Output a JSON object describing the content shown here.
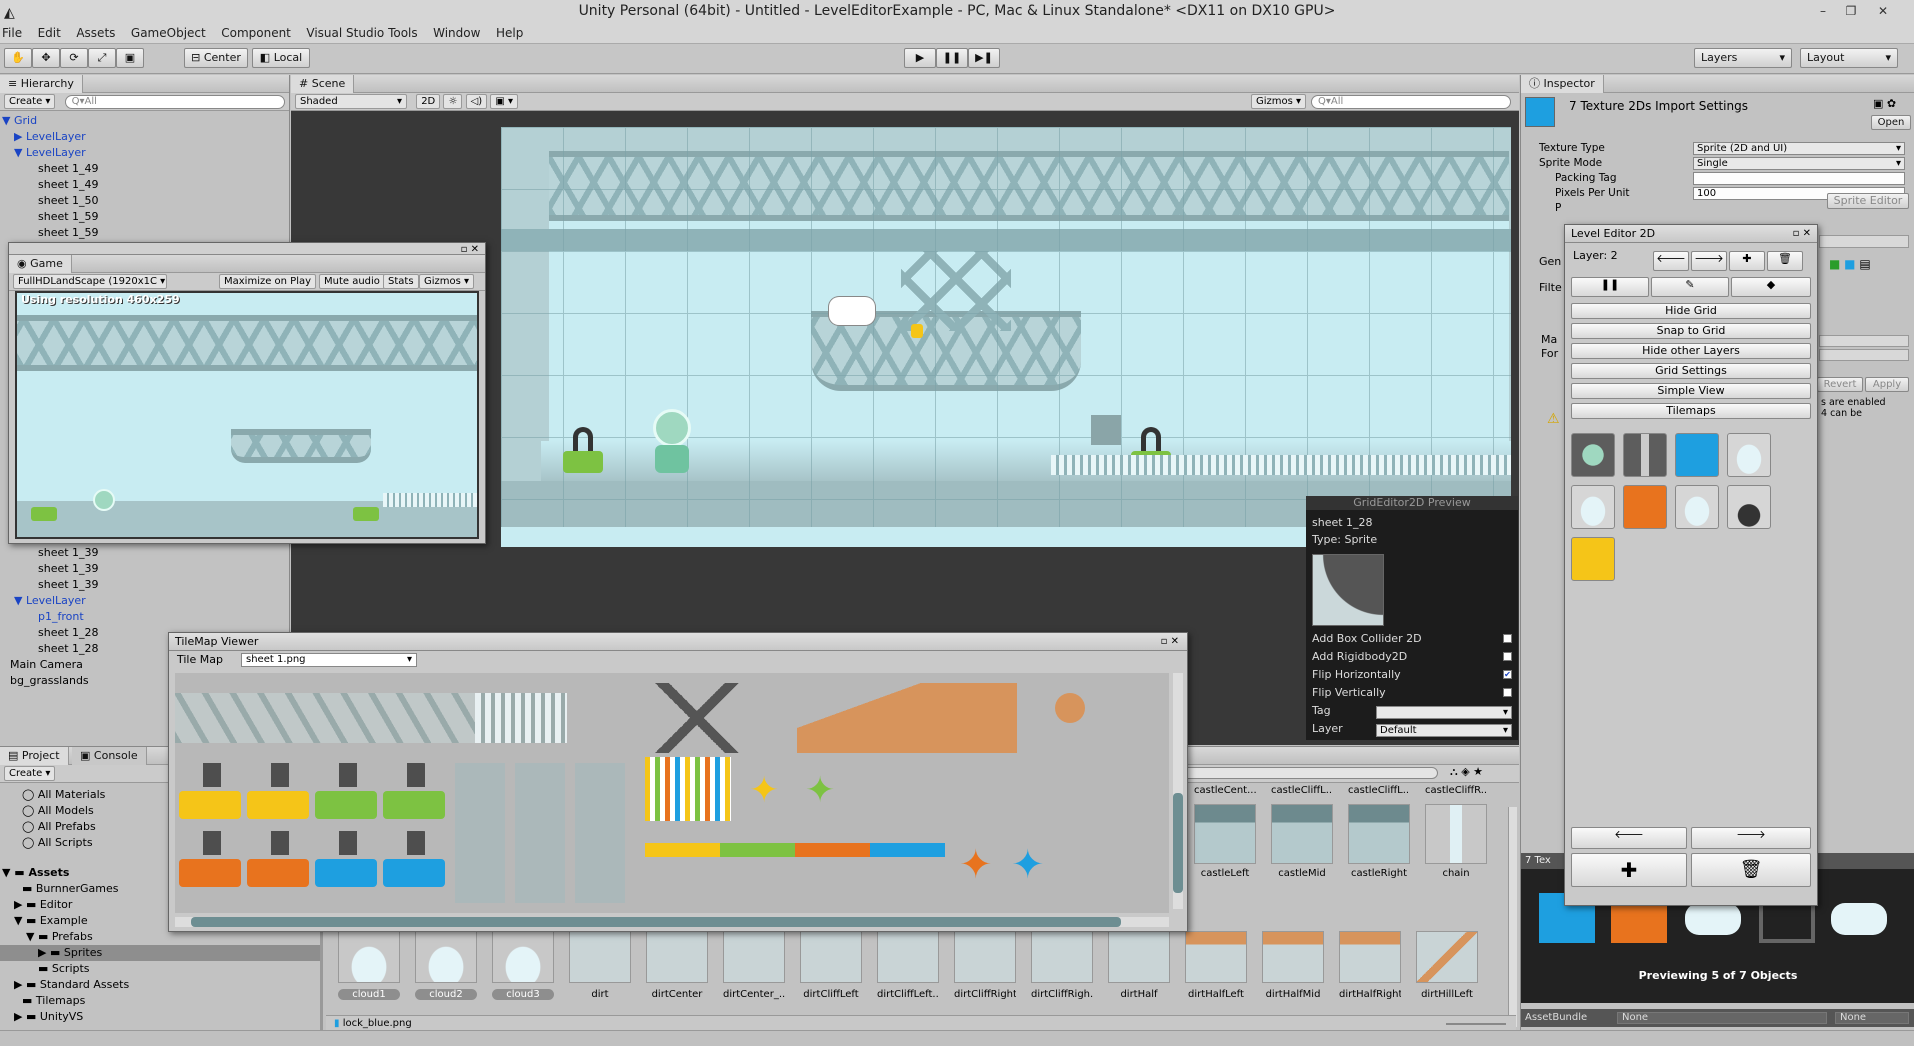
{
  "window": {
    "title": "Unity Personal (64bit) - Untitled - LevelEditorExample - PC, Mac & Linux Standalone* <DX11 on DX10 GPU>",
    "controls": [
      "–",
      "❐",
      "✕"
    ]
  },
  "menu": [
    "File",
    "Edit",
    "Assets",
    "GameObject",
    "Component",
    "Visual Studio Tools",
    "Window",
    "Help"
  ],
  "toolbar": {
    "pivot": "Center",
    "space": "Local",
    "layers": "Layers",
    "layout": "Layout"
  },
  "hierarchy": {
    "tab": "Hierarchy",
    "create": "Create",
    "search_placeholder": "Q▾All",
    "items_top": [
      "Grid",
      "LevelLayer",
      "LevelLayer",
      "sheet 1_49",
      "sheet 1_49",
      "sheet 1_50",
      "sheet 1_59",
      "sheet 1_59"
    ],
    "items_bottom": [
      "sheet 1_39",
      "sheet 1_39",
      "sheet 1_39",
      "LevelLayer",
      "p1_front",
      "sheet 1_28",
      "sheet 1_28",
      "Main Camera",
      "bg_grasslands"
    ]
  },
  "scene": {
    "tab": "Scene",
    "shading": "Shaded",
    "mode2d": "2D",
    "gizmos": "Gizmos",
    "search_placeholder": "Q▾All"
  },
  "game": {
    "tab": "Game",
    "resolution": "FullHDLandScape (1920x1C",
    "maximize": "Maximize on Play",
    "mute": "Mute audio",
    "stats": "Stats",
    "gizmos": "Gizmos",
    "overlay": "Using resolution 460x259"
  },
  "tilemap_viewer": {
    "title": "TileMap Viewer",
    "label": "Tile Map",
    "selected": "sheet 1.png"
  },
  "grid_preview": {
    "title": "GridEditor2D Preview",
    "name": "sheet 1_28",
    "type": "Type: Sprite",
    "options": [
      {
        "label": "Add Box Collider 2D",
        "checked": false
      },
      {
        "label": "Add Rigidbody2D",
        "checked": false
      },
      {
        "label": "Flip Horizontally",
        "checked": true
      },
      {
        "label": "Flip Vertically",
        "checked": false
      }
    ],
    "tag_label": "Tag",
    "tag_value": "",
    "layer_label": "Layer",
    "layer_value": "Default"
  },
  "project": {
    "tab": "Project",
    "console_tab": "Console",
    "create": "Create",
    "favorites": [
      "All Materials",
      "All Models",
      "All Prefabs",
      "All Scripts"
    ],
    "assets_root": "Assets",
    "tree": [
      "BurnnerGames",
      "Editor",
      "Example",
      "Prefabs",
      "Sprites",
      "Scripts",
      "Standard Assets",
      "Tilemaps",
      "UnityVS"
    ],
    "assets_row1_top": [
      "castleCent...",
      "castleCliffL...",
      "castleCliffL...",
      "castleCliffR..."
    ],
    "assets_row1_bottom": [
      "castleLeft",
      "castleMid",
      "castleRight",
      "chain"
    ],
    "assets_row2": [
      "cloud1",
      "cloud2",
      "cloud3",
      "dirt",
      "dirtCenter",
      "dirtCenter_...",
      "dirtCliffLeft",
      "dirtCliffLeft...",
      "dirtCliffRight",
      "dirtCliffRigh...",
      "dirtHalf",
      "dirtHalfLeft",
      "dirtHalfMid",
      "dirtHalfRight",
      "dirtHillLeft"
    ],
    "status_file": "lock_blue.png"
  },
  "inspector": {
    "tab": "Inspector",
    "header": "7 Texture 2Ds Import Settings",
    "open": "Open",
    "rows": [
      {
        "label": "Texture Type",
        "value": "Sprite (2D and UI)"
      },
      {
        "label": "Sprite Mode",
        "value": "Single"
      },
      {
        "label": "Packing Tag",
        "value": ""
      },
      {
        "label": "Pixels Per Unit",
        "value": "100"
      }
    ],
    "pivot_short": "P",
    "sprite_editor": "Sprite Editor",
    "gen_label": "Gen",
    "filter_label": "Filte",
    "max_label": "Ma",
    "format_label": "For",
    "revert": "Revert",
    "apply": "Apply",
    "warn_text_1": "s are enabled",
    "warn_text_2": "4 can be",
    "preview_tab": "7 Tex",
    "preview_caption": "Previewing 5 of 7 Objects",
    "assetbundle_label": "AssetBundle",
    "assetbundle_value": "None",
    "assetbundle_variant": "None"
  },
  "level_editor": {
    "title": "Level Editor 2D",
    "layer": "Layer: 2",
    "buttons": [
      "Hide Grid",
      "Snap to Grid",
      "Hide other Layers",
      "Grid Settings",
      "Simple View",
      "Tilemaps"
    ]
  },
  "colors": {
    "sky": "#c8ecf2",
    "green": "#7dc242",
    "yellow": "#f5c518",
    "orange": "#e8731e",
    "blue": "#1e9fe0"
  }
}
